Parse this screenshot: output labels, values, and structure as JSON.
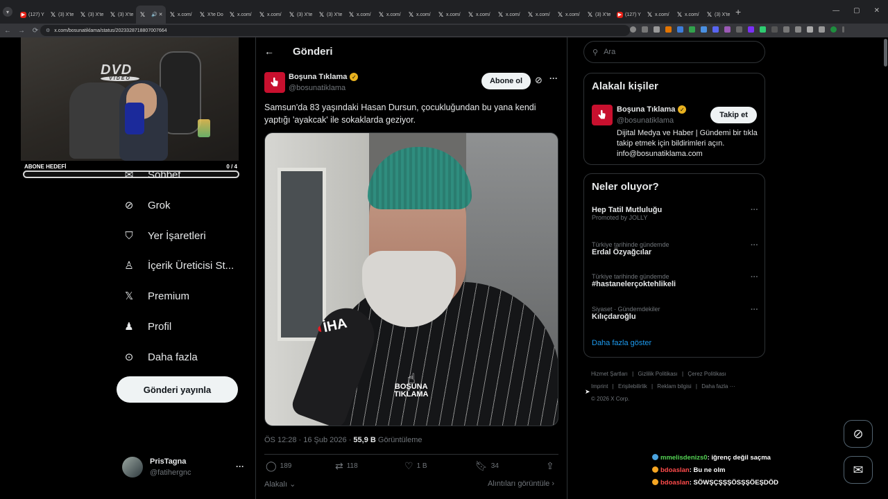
{
  "browser": {
    "tabs": [
      {
        "label": "(127) Y",
        "icon": "yt"
      },
      {
        "label": "(3) X'te",
        "icon": "x"
      },
      {
        "label": "(3) X'te",
        "icon": "x"
      },
      {
        "label": "(3) X'te",
        "icon": "x"
      },
      {
        "label": "",
        "icon": "x",
        "active": true
      },
      {
        "label": "x.com/",
        "icon": "x"
      },
      {
        "label": "X'te Do",
        "icon": "x"
      },
      {
        "label": "x.com/",
        "icon": "x"
      },
      {
        "label": "x.com/",
        "icon": "x"
      },
      {
        "label": "(3) X'te",
        "icon": "x"
      },
      {
        "label": "(3) X'te",
        "icon": "x"
      },
      {
        "label": "x.com/",
        "icon": "x"
      },
      {
        "label": "x.com/",
        "icon": "x"
      },
      {
        "label": "x.com/",
        "icon": "x"
      },
      {
        "label": "x.com/",
        "icon": "x"
      },
      {
        "label": "x.com/",
        "icon": "x"
      },
      {
        "label": "x.com/",
        "icon": "x"
      },
      {
        "label": "x.com/",
        "icon": "x"
      },
      {
        "label": "x.com/",
        "icon": "x"
      },
      {
        "label": "(3) X'te",
        "icon": "x"
      },
      {
        "label": "(127) Y",
        "icon": "yt"
      },
      {
        "label": "x.com/",
        "icon": "x"
      },
      {
        "label": "x.com/",
        "icon": "x"
      },
      {
        "label": "(3) X'te",
        "icon": "x"
      }
    ],
    "url": "x.com/bosunatiklama/status/2023328718807007664"
  },
  "stream": {
    "goal_label": "ABONE HEDEFİ",
    "goal_count": "0 / 4",
    "goal_progress": 0
  },
  "nav": {
    "items": [
      {
        "label": "Sohbet",
        "icon": "mail-icon"
      },
      {
        "label": "Grok",
        "icon": "grok-icon"
      },
      {
        "label": "Yer İşaretleri",
        "icon": "bookmark-icon"
      },
      {
        "label": "İçerik Üreticisi St...",
        "icon": "creator-studio-icon"
      },
      {
        "label": "Premium",
        "icon": "x-logo-icon"
      },
      {
        "label": "Profil",
        "icon": "profile-icon"
      },
      {
        "label": "Daha fazla",
        "icon": "more-circle-icon"
      }
    ],
    "post_button": "Gönderi yayınla",
    "account": {
      "name": "PrisTagna",
      "handle": "@fatihergnc",
      "more": "···"
    }
  },
  "post": {
    "header_title": "Gönderi",
    "author_name": "Boşuna Tıklama",
    "author_handle": "@bosunatiklama",
    "subscribe_label": "Abone ol",
    "text": "Samsun'da 83 yaşındaki Hasan Dursun, çocukluğundan bu yana kendi yaptığı 'ayakcak' ile sokaklarda geziyor.",
    "media_mic_logo": "İHA",
    "media_watermark_line1": "BOŞUNA",
    "media_watermark_line2": "TIKLAMA",
    "time": "ÖS 12:28 · 16 Şub 2026 · ",
    "views_count": "55,9 B",
    "views_label": " Görüntüleme",
    "replies": "189",
    "reposts": "118",
    "likes": "1 B",
    "bookmarks": "34",
    "relevance": "Alakalı",
    "quotes_link": "Alıntıları görüntüle"
  },
  "sidebar": {
    "search_placeholder": "Ara",
    "related": {
      "title": "Alakalı kişiler",
      "name": "Boşuna Tıklama",
      "handle": "@bosunatiklama",
      "follow_label": "Takip et",
      "bio": "Dijital Medya ve Haber | Gündemi bir tıkla takip etmek için bildirimleri açın. info@bosunatiklama.com"
    },
    "trends": {
      "title": "Neler oluyor?",
      "items": [
        {
          "sub": "Promoted by JOLLY",
          "name": "Hep Tatil Mutluluğu",
          "promoted": true
        },
        {
          "sub": "Türkiye tarihinde gündemde",
          "name": "Erdal Özyağcılar"
        },
        {
          "sub": "Türkiye tarihinde gündemde",
          "name": "#hastanelerçoktehlikeli"
        },
        {
          "sub": "Siyaset · Gündemdekiler",
          "name": "Kılıçdaroğlu"
        }
      ],
      "show_more": "Daha fazla göster"
    },
    "footer": {
      "links": [
        "Hizmet Şartları",
        "Gizlilik Politikası",
        "Çerez Politikası",
        "Imprint",
        "Erişilebilirlik",
        "Reklam bilgisi",
        "Daha fazla ···"
      ],
      "copyright": "© 2026 X Corp."
    }
  },
  "chat": [
    {
      "user": "mmelisdenizs0",
      "message": ": iğrenç değil saçma",
      "color": "#54d354"
    },
    {
      "user": "bdoaslan",
      "message": ": Bu ne olm",
      "color": "#ff4b4b"
    },
    {
      "user": "bdoaslan",
      "message": ": SÖWŞÇŞŞŞÖSŞŞÖEŞDÖD",
      "color": "#ff4b4b"
    }
  ],
  "colors": {
    "accent": "#1d9bf0",
    "border": "#2f3336",
    "muted": "#71767b",
    "brand_red": "#c8102e",
    "verified_gold": "#e8b11f"
  }
}
